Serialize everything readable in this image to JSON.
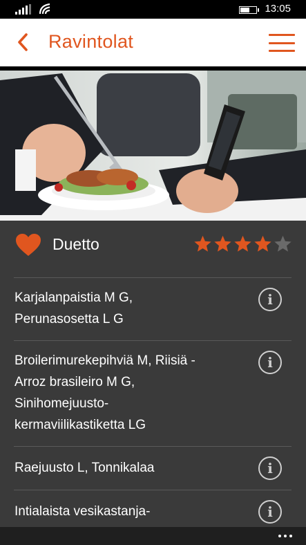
{
  "status_bar": {
    "time": "13:05",
    "signal_icon": "signal-bars-icon",
    "wifi_icon": "wifi-icon",
    "battery_icon": "battery-icon"
  },
  "header": {
    "title": "Ravintolat",
    "back_icon": "chevron-left-icon",
    "menu_icon": "hamburger-menu-icon",
    "accent_color": "#e0561f"
  },
  "hero": {
    "image": "photo of person eating a salad while holding a smartphone"
  },
  "restaurant": {
    "name": "Duetto",
    "favorite_icon": "heart-icon",
    "rating": 4,
    "rating_max": 5
  },
  "menu_items": [
    {
      "lines": [
        "Karjalanpaistia M G,",
        "Perunasosetta L G"
      ],
      "info_icon": "info-icon"
    },
    {
      "lines": [
        "Broilerimurekepihviä M, Riisiä -",
        "Arroz brasileiro M G,",
        "Sinihomejuusto-",
        "kermaviilikastiketta LG"
      ],
      "info_icon": "info-icon"
    },
    {
      "lines": [
        "Raejuusto L, Tonnikalaa"
      ],
      "info_icon": "info-icon"
    },
    {
      "lines": [
        "Intialaista vesikastanja-"
      ],
      "info_icon": "info-icon"
    }
  ],
  "app_bar": {
    "more_icon": "more-ellipsis-icon"
  }
}
